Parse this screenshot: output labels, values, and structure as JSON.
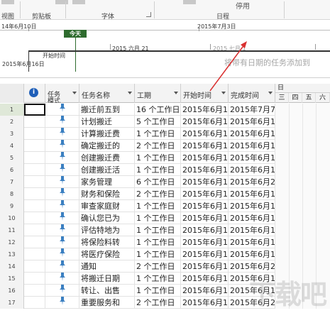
{
  "ribbon": {
    "partial_left": "视图",
    "groups": [
      "剪贴板",
      "字体",
      "日程"
    ],
    "partial_right": "停用"
  },
  "timeline": {
    "start_date_top": "14年6月10日",
    "end_date_top": "2015年7月3日",
    "today_label": "今天",
    "mid_date": "2015 六月 21",
    "faded_date": "2015 七月 1",
    "start_label": "开始时间",
    "start_date": "2015年6月16日",
    "hint": "将带有日期的任务添加到"
  },
  "table": {
    "headers": {
      "mode": "任务\n模式",
      "name": "任务名称",
      "duration": "工期",
      "start": "开始时间",
      "finish": "完成时间"
    },
    "gantt_header": "日",
    "gantt_days": [
      "三",
      "四",
      "五",
      "六"
    ],
    "rows": [
      {
        "id": "1",
        "name": "搬迁前五到",
        "duration": "16 个工作日",
        "start": "2015年6月1",
        "finish": "2015年7月7"
      },
      {
        "id": "2",
        "name": "计划搬迁",
        "duration": "5 个工作日",
        "start": "2015年6月1",
        "finish": "2015年6月1"
      },
      {
        "id": "3",
        "name": "计算搬迁费",
        "duration": "1 个工作日",
        "start": "2015年6月1",
        "finish": "2015年6月1"
      },
      {
        "id": "4",
        "name": "确定搬迁的",
        "duration": "2 个工作日",
        "start": "2015年6月1",
        "finish": "2015年6月1"
      },
      {
        "id": "5",
        "name": "创建搬迁费",
        "duration": "1 个工作日",
        "start": "2015年6月1",
        "finish": "2015年6月1"
      },
      {
        "id": "6",
        "name": "创建搬迁活",
        "duration": "1 个工作日",
        "start": "2015年6月1",
        "finish": "2015年6月1"
      },
      {
        "id": "7",
        "name": "家务管理",
        "duration": "6 个工作日",
        "start": "2015年6月1",
        "finish": "2015年6月2"
      },
      {
        "id": "8",
        "name": "财务和保险",
        "duration": "2 个工作日",
        "start": "2015年6月1",
        "finish": "2015年6月1"
      },
      {
        "id": "9",
        "name": "审查家庭财",
        "duration": "1 个工作日",
        "start": "2015年6月1",
        "finish": "2015年6月1"
      },
      {
        "id": "10",
        "name": "确认您已为",
        "duration": "1 个工作日",
        "start": "2015年6月1",
        "finish": "2015年6月1"
      },
      {
        "id": "11",
        "name": "评估特地为",
        "duration": "1 个工作日",
        "start": "2015年6月1",
        "finish": "2015年6月1"
      },
      {
        "id": "12",
        "name": "将保险料转",
        "duration": "1 个工作日",
        "start": "2015年6月1",
        "finish": "2015年6月1"
      },
      {
        "id": "13",
        "name": "将医疗保险",
        "duration": "1 个工作日",
        "start": "2015年6月1",
        "finish": "2015年6月1"
      },
      {
        "id": "14",
        "name": "通知",
        "duration": "2 个工作日",
        "start": "2015年6月1",
        "finish": "2015年6月2"
      },
      {
        "id": "15",
        "name": "将搬迁日期",
        "duration": "1 个工作日",
        "start": "2015年6月1",
        "finish": "2015年6月1"
      },
      {
        "id": "16",
        "name": "转让、出售",
        "duration": "1 个工作日",
        "start": "2015年6月1",
        "finish": "2015年6月1"
      },
      {
        "id": "17",
        "name": "重要服务和",
        "duration": "2 个工作日",
        "start": "2015年6月1",
        "finish": "2015年6月2"
      }
    ]
  },
  "watermark": "下载吧",
  "colors": {
    "today": "#2e6b2e",
    "pin": "#3a7fc1",
    "info": "#1f5fb8",
    "arrow": "#d93030"
  }
}
